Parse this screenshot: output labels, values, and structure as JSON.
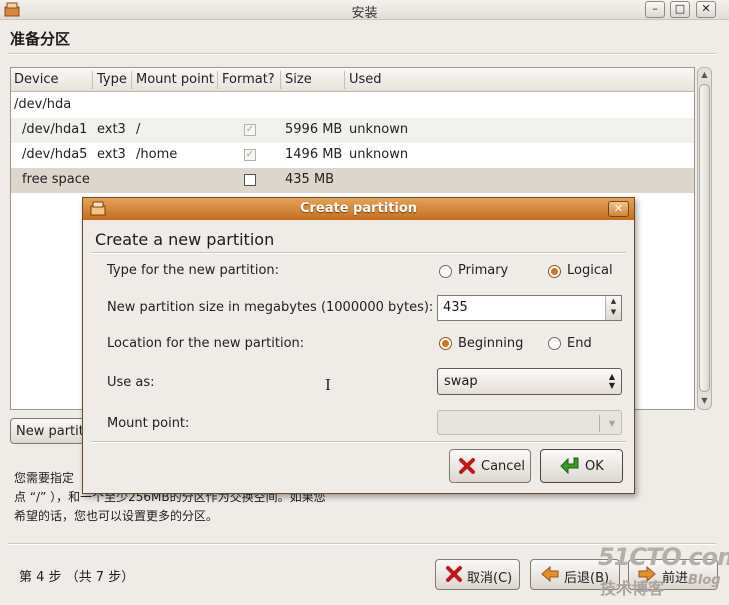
{
  "window": {
    "title": "安装",
    "page_title": "准备分区"
  },
  "table": {
    "columns": [
      "Device",
      "Type",
      "Mount point",
      "Format?",
      "Size",
      "Used"
    ],
    "rows": [
      {
        "device": "/dev/hda",
        "type": "",
        "mount": "",
        "format": "none",
        "size": "",
        "used": ""
      },
      {
        "device": "/dev/hda1",
        "type": "ext3",
        "mount": "/",
        "format": "checked",
        "size": "5996 MB",
        "used": "unknown"
      },
      {
        "device": "/dev/hda5",
        "type": "ext3",
        "mount": "/home",
        "format": "checked",
        "size": "1496 MB",
        "used": "unknown"
      },
      {
        "device": "free space",
        "type": "",
        "mount": "",
        "format": "unchecked",
        "size": "435 MB",
        "used": ""
      }
    ]
  },
  "partition_button": "New partiti",
  "description": {
    "line1": "您需要指定",
    "line2": "点 “/” ），和一个至少256MB的分区作为交换空间。如果您",
    "line3": "希望的话，您也可以设置更多的分区。"
  },
  "footer": {
    "step": "第 4 步 （共 7 步）",
    "cancel": "取消(C)",
    "back": "后退(B)",
    "forward": "前进"
  },
  "watermark": {
    "site": "51CTO.com",
    "subtitle": "技术博客",
    "blog": "Blog"
  },
  "dialog": {
    "title": "Create partition",
    "heading": "Create a new partition",
    "type_label": "Type for the new partition:",
    "type_primary": "Primary",
    "type_logical": "Logical",
    "type_selected": "Logical",
    "size_label": "New partition size in megabytes (1000000 bytes):",
    "size_value": "435",
    "location_label": "Location for the new partition:",
    "location_beginning": "Beginning",
    "location_end": "End",
    "location_selected": "Beginning",
    "use_as_label": "Use as:",
    "use_as_value": "swap",
    "mount_label": "Mount point:",
    "mount_value": "",
    "cancel": "Cancel",
    "ok": "OK"
  },
  "colors": {
    "dialog_title_bar": "#c46d1e",
    "selected_row": "#dcd6cd",
    "radio_active": "#d0741f",
    "ok_icon": "#3a9a22",
    "cancel_icon": "#c4161c"
  }
}
